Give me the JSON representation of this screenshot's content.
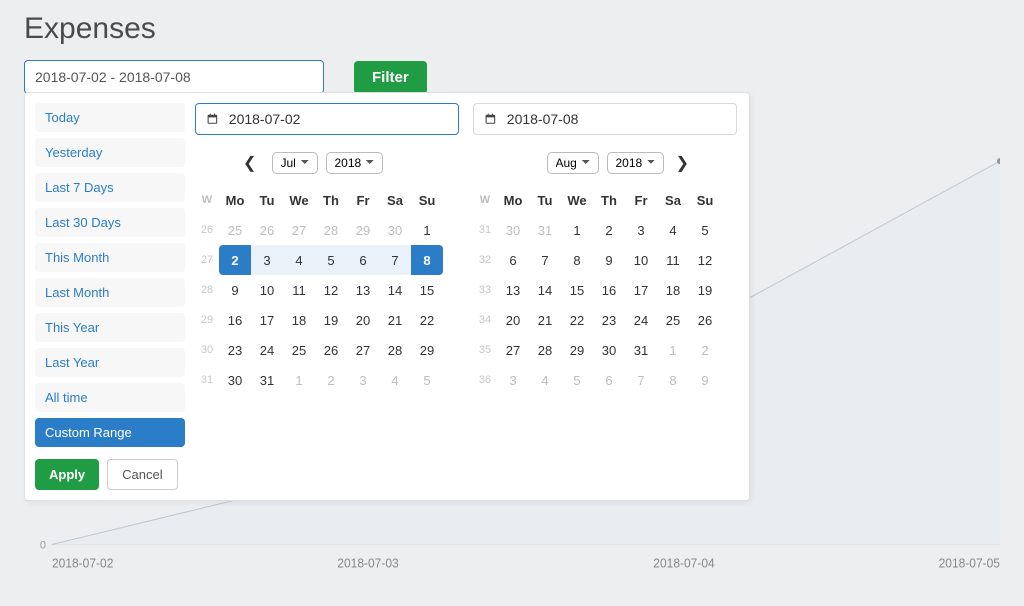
{
  "title": "Expenses",
  "date_input_value": "2018-07-02 - 2018-07-08",
  "filter_btn": "Filter",
  "presets": [
    "Today",
    "Yesterday",
    "Last 7 Days",
    "Last 30 Days",
    "This Month",
    "Last Month",
    "This Year",
    "Last Year",
    "All time",
    "Custom Range"
  ],
  "active_preset_index": 9,
  "apply_label": "Apply",
  "cancel_label": "Cancel",
  "left_value": "2018-07-02",
  "right_value": "2018-07-08",
  "left_month": "Jul",
  "left_year": "2018",
  "right_month": "Aug",
  "right_year": "2018",
  "dow_header": [
    "W",
    "Mo",
    "Tu",
    "We",
    "Th",
    "Fr",
    "Sa",
    "Su"
  ],
  "left_weeks": [
    26,
    27,
    28,
    29,
    30,
    31
  ],
  "right_weeks": [
    31,
    32,
    33,
    34,
    35,
    36
  ],
  "left_days": [
    {
      "n": 25,
      "off": true
    },
    {
      "n": 26,
      "off": true
    },
    {
      "n": 27,
      "off": true
    },
    {
      "n": 28,
      "off": true
    },
    {
      "n": 29,
      "off": true
    },
    {
      "n": 30,
      "off": true
    },
    {
      "n": 1
    },
    {
      "n": 2,
      "selstart": true
    },
    {
      "n": 3,
      "range": true
    },
    {
      "n": 4,
      "range": true
    },
    {
      "n": 5,
      "range": true
    },
    {
      "n": 6,
      "range": true
    },
    {
      "n": 7,
      "range": true
    },
    {
      "n": 8,
      "selend": true
    },
    {
      "n": 9
    },
    {
      "n": 10
    },
    {
      "n": 11
    },
    {
      "n": 12
    },
    {
      "n": 13
    },
    {
      "n": 14
    },
    {
      "n": 15
    },
    {
      "n": 16
    },
    {
      "n": 17
    },
    {
      "n": 18
    },
    {
      "n": 19
    },
    {
      "n": 20
    },
    {
      "n": 21
    },
    {
      "n": 22
    },
    {
      "n": 23
    },
    {
      "n": 24
    },
    {
      "n": 25
    },
    {
      "n": 26
    },
    {
      "n": 27
    },
    {
      "n": 28
    },
    {
      "n": 29
    },
    {
      "n": 30
    },
    {
      "n": 31
    },
    {
      "n": 1,
      "off": true
    },
    {
      "n": 2,
      "off": true
    },
    {
      "n": 3,
      "off": true
    },
    {
      "n": 4,
      "off": true
    },
    {
      "n": 5,
      "off": true
    }
  ],
  "right_days": [
    {
      "n": 30,
      "off": true
    },
    {
      "n": 31,
      "off": true
    },
    {
      "n": 1
    },
    {
      "n": 2
    },
    {
      "n": 3
    },
    {
      "n": 4
    },
    {
      "n": 5
    },
    {
      "n": 6
    },
    {
      "n": 7
    },
    {
      "n": 8
    },
    {
      "n": 9
    },
    {
      "n": 10
    },
    {
      "n": 11
    },
    {
      "n": 12
    },
    {
      "n": 13
    },
    {
      "n": 14
    },
    {
      "n": 15
    },
    {
      "n": 16
    },
    {
      "n": 17
    },
    {
      "n": 18
    },
    {
      "n": 19
    },
    {
      "n": 20
    },
    {
      "n": 21
    },
    {
      "n": 22
    },
    {
      "n": 23
    },
    {
      "n": 24
    },
    {
      "n": 25
    },
    {
      "n": 26
    },
    {
      "n": 27
    },
    {
      "n": 28
    },
    {
      "n": 29
    },
    {
      "n": 30
    },
    {
      "n": 31
    },
    {
      "n": 1,
      "off": true
    },
    {
      "n": 2,
      "off": true
    },
    {
      "n": 3,
      "off": true
    },
    {
      "n": 4,
      "off": true
    },
    {
      "n": 5,
      "off": true
    },
    {
      "n": 6,
      "off": true
    },
    {
      "n": 7,
      "off": true
    },
    {
      "n": 8,
      "off": true
    },
    {
      "n": 9,
      "off": true
    }
  ],
  "chart_data": {
    "type": "area",
    "x": [
      "2018-07-02",
      "2018-07-03",
      "2018-07-04",
      "2018-07-05"
    ],
    "values": [
      0,
      20,
      55,
      100
    ],
    "ylim": [
      0,
      100
    ],
    "y_zero_label": "0",
    "xlabel": "",
    "ylabel": ""
  }
}
